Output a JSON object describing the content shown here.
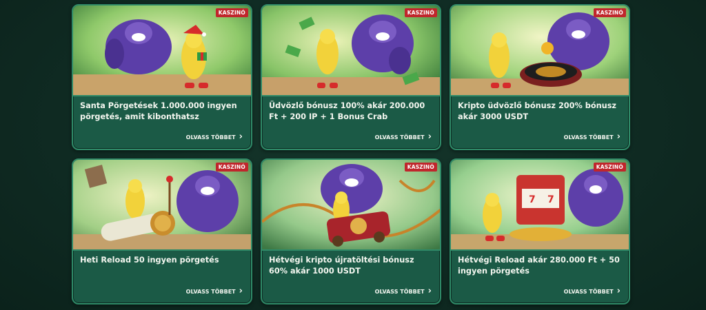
{
  "cards": [
    {
      "badge": "KASZINÓ",
      "title": "Santa Pörgetések 1.000.000 ingyen pörgetés, amit kibonthatsz",
      "link": "OLVASS TÖBBET",
      "bg": "#a8d47a"
    },
    {
      "badge": "KASZINÓ",
      "title": "Üdvözlő bónusz 100% akár 200.000 Ft + 200 IP + 1 Bonus Crab",
      "link": "OLVASS TÖBBET",
      "bg": "#9ccf6e"
    },
    {
      "badge": "KASZINÓ",
      "title": "Kripto üdvözlő bónusz 200% bónusz akár 3000 USDT",
      "link": "OLVASS TÖBBET",
      "bg": "#b7dc82"
    },
    {
      "badge": "KASZINÓ",
      "title": "Heti Reload 50 ingyen pörgetés",
      "link": "OLVASS TÖBBET",
      "bg": "#b2d68a"
    },
    {
      "badge": "KASZINÓ",
      "title": "Hétvégi kripto újratöltési bónusz 60% akár 1000 USDT",
      "link": "OLVASS TÖBBET",
      "bg": "#a6d28a"
    },
    {
      "badge": "KASZINÓ",
      "title": "Hétvégi Reload akár 280.000 Ft + 50 ingyen pörgetés",
      "link": "OLVASS TÖBBET",
      "bg": "#9ed08e"
    }
  ]
}
